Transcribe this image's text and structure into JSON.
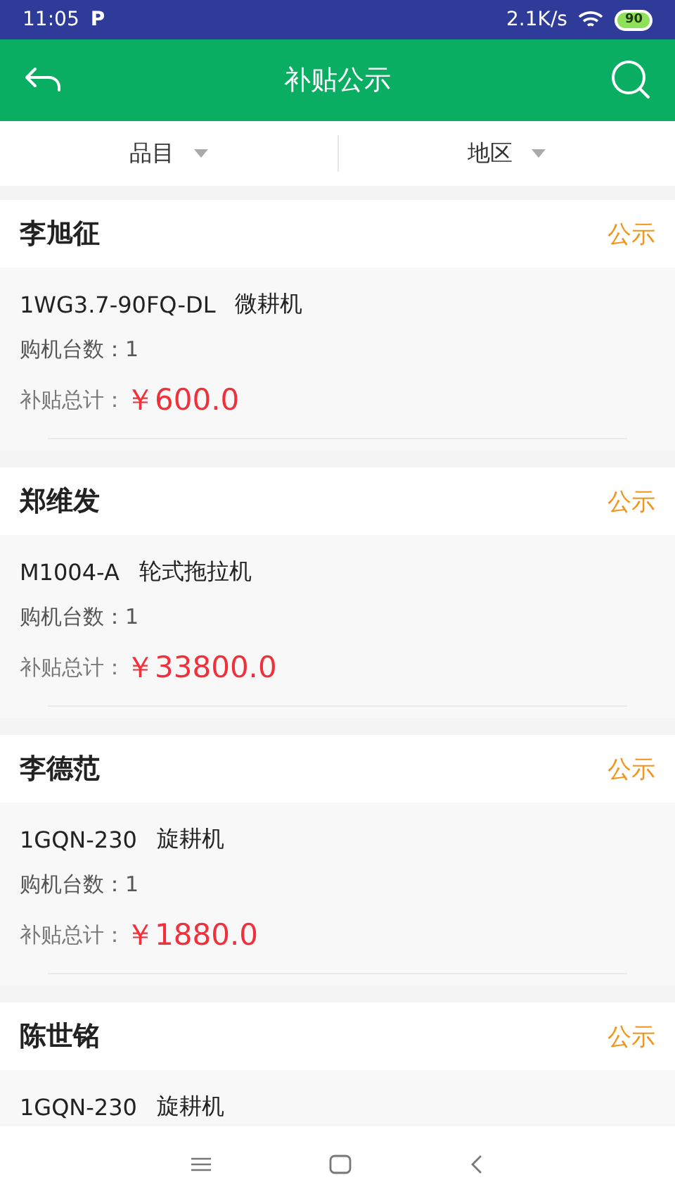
{
  "status_bar": {
    "time": "11:05",
    "app_badge": "P",
    "speed": "2.1K/s",
    "battery": "90"
  },
  "header": {
    "title": "补贴公示"
  },
  "filters": [
    {
      "label": "品目"
    },
    {
      "label": "地区"
    }
  ],
  "records": [
    {
      "name": "李旭征",
      "tag": "公示",
      "model": "1WG3.7-90FQ-DL",
      "machine": "微耕机",
      "count": "购机台数：1",
      "total_label": "补贴总计：",
      "total": "￥600.0"
    },
    {
      "name": "郑维发",
      "tag": "公示",
      "model": "M1004-A",
      "machine": "轮式拖拉机",
      "count": "购机台数：1",
      "total_label": "补贴总计：",
      "total": "￥33800.0"
    },
    {
      "name": "李德范",
      "tag": "公示",
      "model": "1GQN-230",
      "machine": "旋耕机",
      "count": "购机台数：1",
      "total_label": "补贴总计：",
      "total": "￥1880.0"
    },
    {
      "name": "陈世铭",
      "tag": "公示",
      "model": "1GQN-230",
      "machine": "旋耕机"
    }
  ]
}
